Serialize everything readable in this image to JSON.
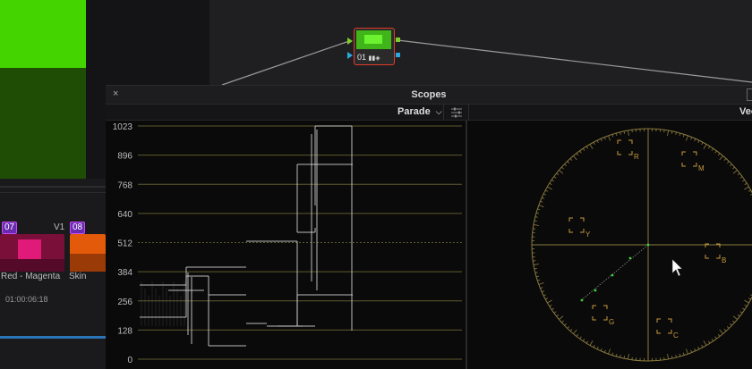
{
  "node": {
    "number": "01"
  },
  "clips": [
    {
      "number": "07",
      "track": "V1",
      "label": "Red - Magenta"
    },
    {
      "number": "08",
      "label": "Skin"
    }
  ],
  "timecode": "01:00:06:18",
  "scopes": {
    "title": "Scopes",
    "close_symbol": "×",
    "left_scope_mode": "Parade",
    "right_scope_label": "Vec",
    "parade_ticks": [
      "1023",
      "896",
      "768",
      "640",
      "512",
      "384",
      "256",
      "128",
      "0"
    ],
    "vector_targets": [
      "R",
      "M",
      "Y",
      "B",
      "G",
      "C"
    ]
  },
  "icons": [
    "close-icon",
    "chevron-down-icon",
    "scope-settings-icon",
    "mouse-cursor-icon"
  ],
  "colors": {
    "accent_red": "#e23b2b",
    "green_bright": "#44d400",
    "graticule": "#8a7a3e",
    "trace": "#d9d9d9"
  }
}
